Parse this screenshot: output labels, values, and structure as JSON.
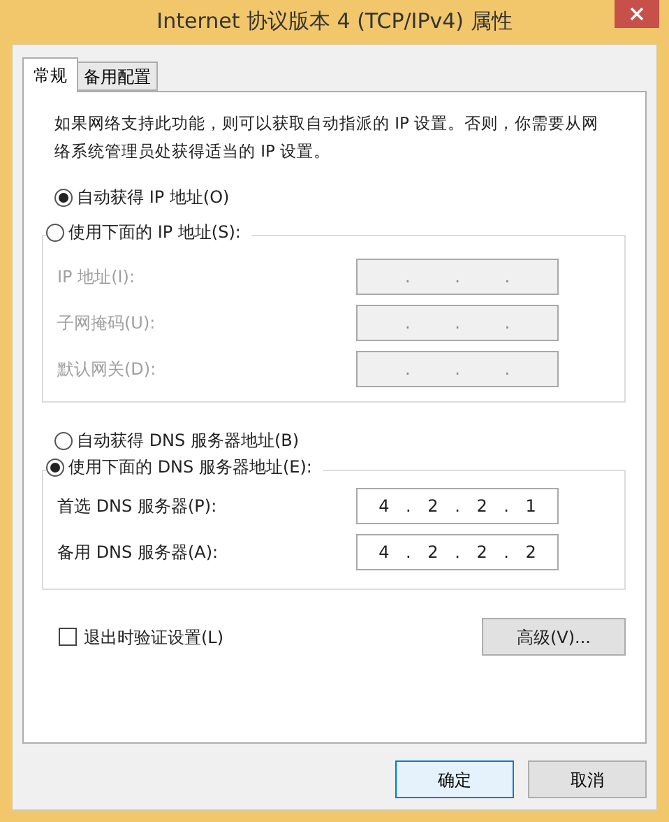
{
  "window": {
    "title": "Internet 协议版本 4 (TCP/IPv4) 属性"
  },
  "tabs": [
    {
      "label": "常规",
      "selected": true
    },
    {
      "label": "备用配置",
      "selected": false
    }
  ],
  "description": "如果网络支持此功能，则可以获取自动指派的 IP 设置。否则，你需要从网络系统管理员处获得适当的 IP 设置。",
  "ip_auto": {
    "label": "自动获得 IP 地址(O)",
    "selected": true
  },
  "ip_manual": {
    "label": "使用下面的 IP 地址(S):",
    "selected": false
  },
  "ip_fields": [
    {
      "label": "IP 地址(I):",
      "value": ". . .",
      "disabled": true
    },
    {
      "label": "子网掩码(U):",
      "value": ". . .",
      "disabled": true
    },
    {
      "label": "默认网关(D):",
      "value": ". . .",
      "disabled": true
    }
  ],
  "dns_auto": {
    "label": "自动获得 DNS 服务器地址(B)",
    "selected": false
  },
  "dns_manual": {
    "label": "使用下面的 DNS 服务器地址(E):",
    "selected": true
  },
  "dns_fields": [
    {
      "label": "首选 DNS 服务器(P):",
      "value": "4 . 2 . 2 . 1",
      "disabled": false
    },
    {
      "label": "备用 DNS 服务器(A):",
      "value": "4 . 2 . 2 . 2",
      "disabled": false
    }
  ],
  "validate_checkbox": {
    "label": "退出时验证设置(L)",
    "checked": false
  },
  "advanced_button": "高级(V)...",
  "buttons": [
    "确定",
    "取消"
  ]
}
